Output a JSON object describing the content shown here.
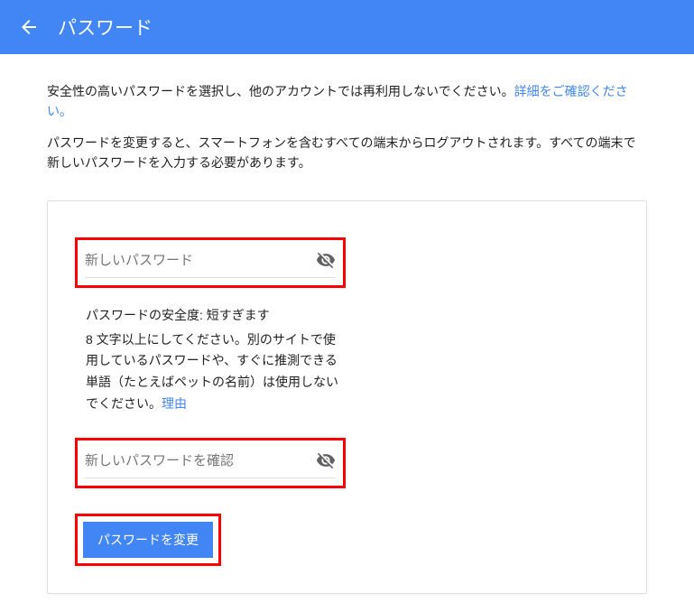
{
  "header": {
    "title": "パスワード"
  },
  "intro": {
    "text1_part1": "安全性の高いパスワードを選択し、他のアカウントでは再利用しないでください。",
    "learn_more": "詳細をご確認ください。",
    "text2": "パスワードを変更すると、スマートフォンを含むすべての端末からログアウトされます。すべての端末で新しいパスワードを入力する必要があります。"
  },
  "form": {
    "new_password_placeholder": "新しいパスワード",
    "confirm_password_placeholder": "新しいパスワードを確認",
    "strength_label": "パスワードの安全度: 短すぎます",
    "strength_desc": "8 文字以上にしてください。別のサイトで使用しているパスワードや、すぐに推測できる単語（たとえばペットの名前）は使用しないでください。",
    "reason_link": "理由",
    "submit_label": "パスワードを変更"
  }
}
